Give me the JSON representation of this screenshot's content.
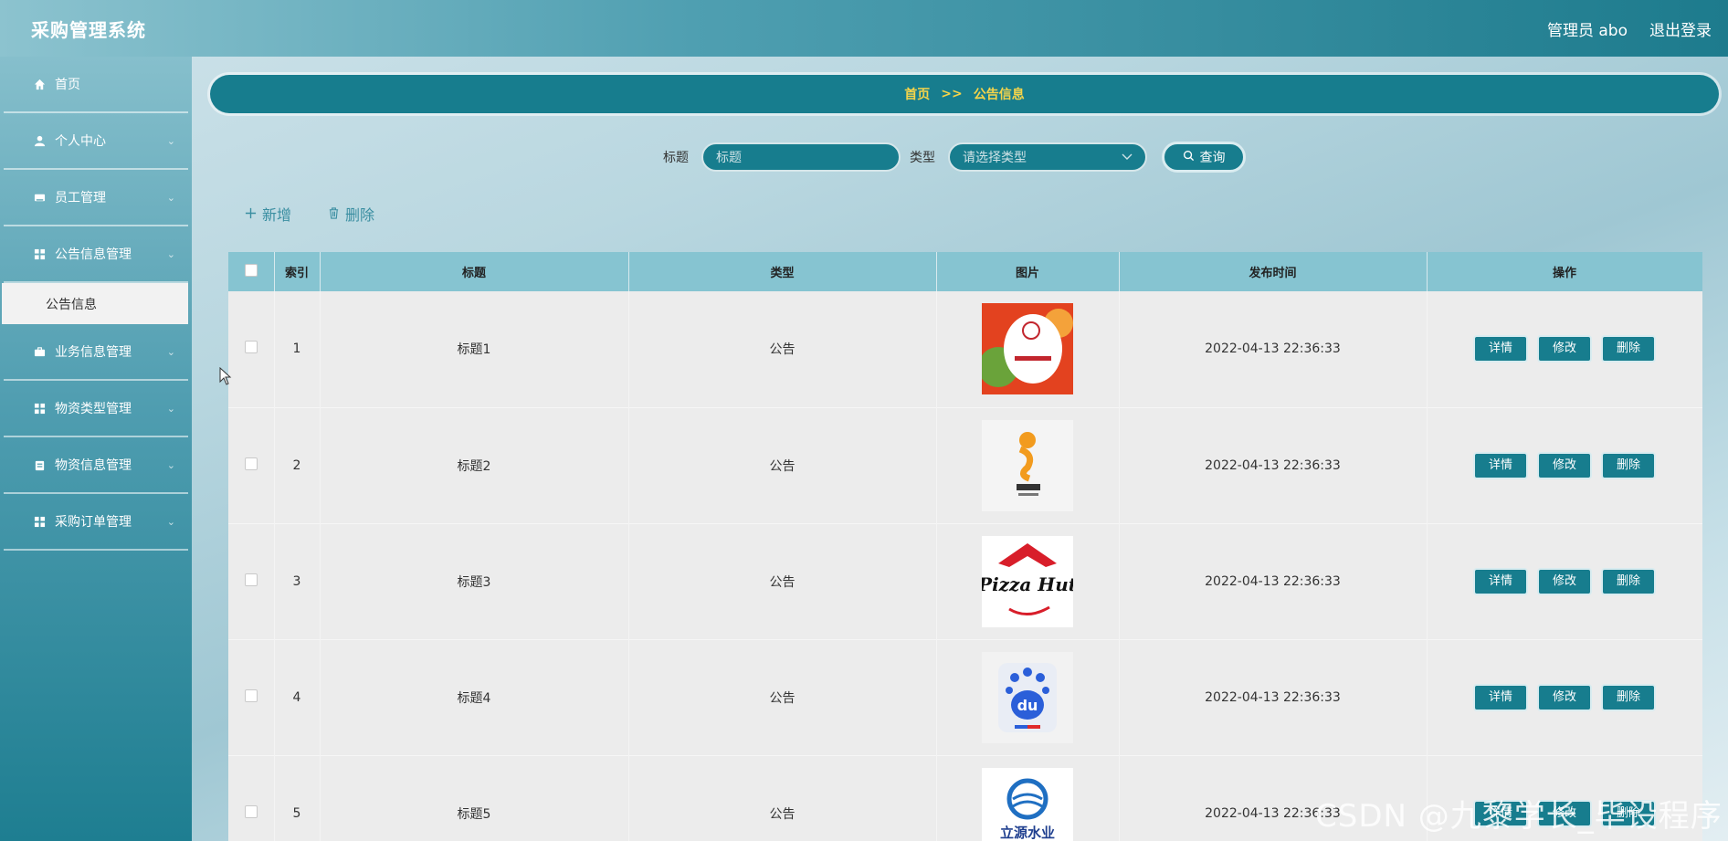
{
  "app": {
    "title": "采购管理系统"
  },
  "header": {
    "user_label": "管理员 abo",
    "logout_label": "退出登录"
  },
  "sidebar": {
    "items": [
      {
        "label": "首页",
        "icon": "home-icon"
      },
      {
        "label": "个人中心",
        "icon": "user-icon"
      },
      {
        "label": "员工管理",
        "icon": "id-card-icon"
      },
      {
        "label": "公告信息管理",
        "icon": "grid-icon"
      },
      {
        "label": "业务信息管理",
        "icon": "briefcase-icon"
      },
      {
        "label": "物资类型管理",
        "icon": "grid-icon"
      },
      {
        "label": "物资信息管理",
        "icon": "clipboard-icon"
      },
      {
        "label": "采购订单管理",
        "icon": "grid-icon"
      }
    ],
    "active_subitem": "公告信息"
  },
  "breadcrumb": {
    "home": "首页",
    "separator": ">>",
    "current": "公告信息"
  },
  "search": {
    "title_label": "标题",
    "title_placeholder": "标题",
    "type_label": "类型",
    "type_placeholder": "请选择类型",
    "query_label": "查询"
  },
  "toolbar": {
    "add_label": "新增",
    "delete_label": "删除"
  },
  "table": {
    "columns": [
      "索引",
      "标题",
      "类型",
      "图片",
      "发布时间",
      "操作"
    ],
    "rows": [
      {
        "index": "1",
        "title": "标题1",
        "type": "公告",
        "image": "pizza-burger-logo",
        "time": "2022-04-13 22:36:33"
      },
      {
        "index": "2",
        "title": "标题2",
        "type": "公告",
        "image": "game-logo",
        "time": "2022-04-13 22:36:33"
      },
      {
        "index": "3",
        "title": "标题3",
        "type": "公告",
        "image": "pizza-hut-logo",
        "time": "2022-04-13 22:36:33"
      },
      {
        "index": "4",
        "title": "标题4",
        "type": "公告",
        "image": "baidu-logo",
        "time": "2022-04-13 22:36:33"
      },
      {
        "index": "5",
        "title": "标题5",
        "type": "公告",
        "image": "water-company-logo",
        "time": "2022-04-13 22:36:33"
      }
    ],
    "op_labels": {
      "detail": "详情",
      "edit": "修改",
      "delete": "删除"
    }
  },
  "logo_texts": {
    "pizza_hut": "Pizza Hut",
    "baidu": "du",
    "water": "立源水业"
  },
  "watermark": "CSDN @九黎学长_毕设程序",
  "colors": {
    "primary": "#177d8e",
    "header_bg": "#86c4d1",
    "breadcrumb_text": "#f5d44a"
  }
}
